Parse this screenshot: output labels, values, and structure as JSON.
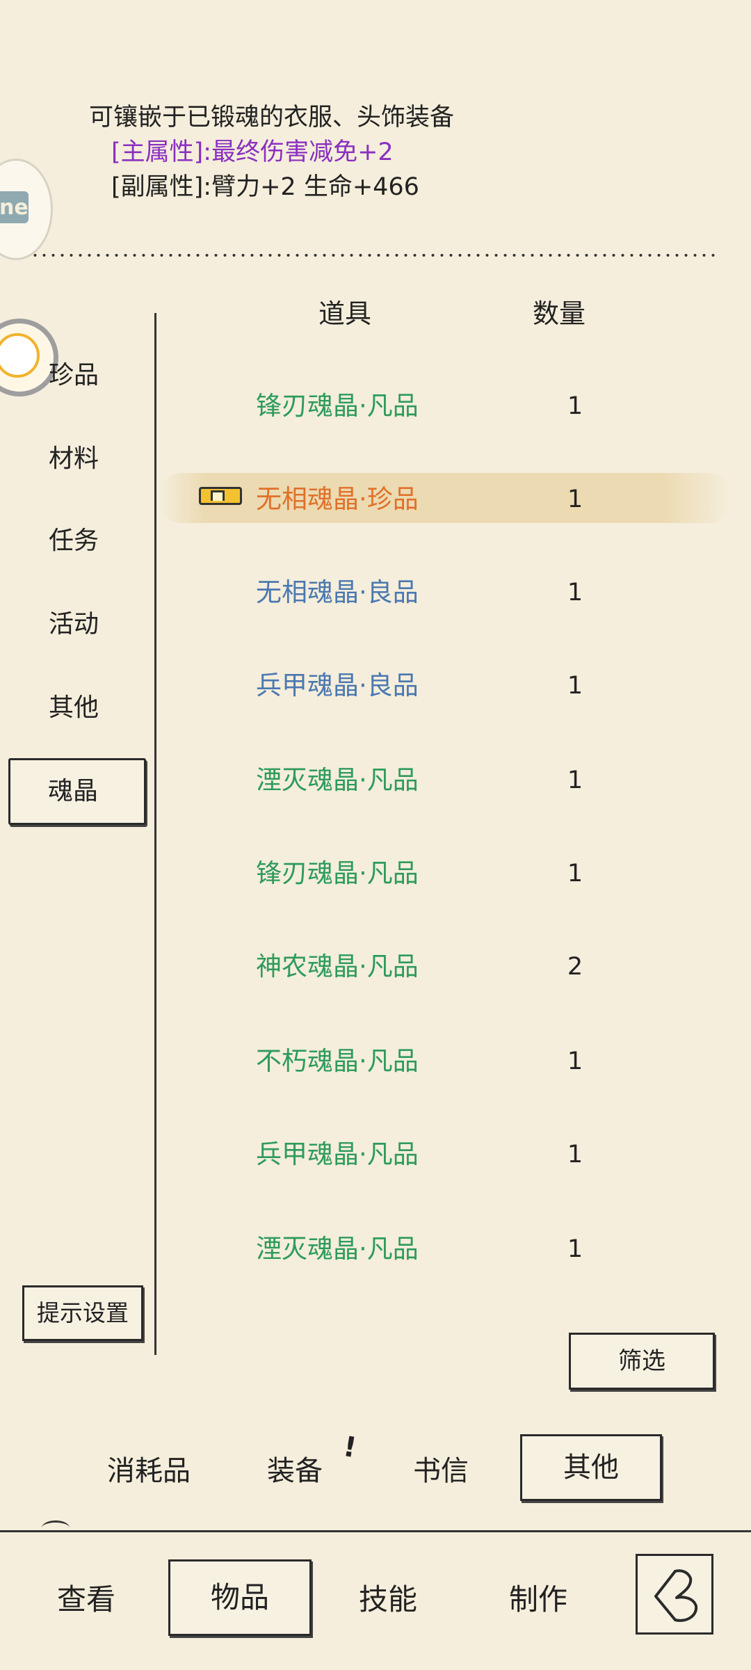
{
  "description": {
    "line1": "可镶嵌于已锻魂的衣服、头饰装备",
    "main_attr": "[主属性]:最终伤害减免+2",
    "sub_attr": "[副属性]:臂力+2 生命+466"
  },
  "avatar_top_text": "ne",
  "categories": [
    "珍品",
    "材料",
    "任务",
    "活动",
    "其他",
    "魂晶"
  ],
  "active_category": "魂晶",
  "table": {
    "header_item": "道具",
    "header_qty": "数量",
    "rows": [
      {
        "name": "锋刃魂晶·凡品",
        "qty": "1",
        "quality": "green"
      },
      {
        "name": "无相魂晶·珍品",
        "qty": "1",
        "quality": "orange",
        "selected": true
      },
      {
        "name": "无相魂晶·良品",
        "qty": "1",
        "quality": "blue"
      },
      {
        "name": "兵甲魂晶·良品",
        "qty": "1",
        "quality": "blue"
      },
      {
        "name": "湮灭魂晶·凡品",
        "qty": "1",
        "quality": "green"
      },
      {
        "name": "锋刃魂晶·凡品",
        "qty": "1",
        "quality": "green"
      },
      {
        "name": "神农魂晶·凡品",
        "qty": "2",
        "quality": "green"
      },
      {
        "name": "不朽魂晶·凡品",
        "qty": "1",
        "quality": "green"
      },
      {
        "name": "兵甲魂晶·凡品",
        "qty": "1",
        "quality": "green"
      },
      {
        "name": "湮灭魂晶·凡品",
        "qty": "1",
        "quality": "green"
      }
    ]
  },
  "buttons": {
    "hint_settings": "提示设置",
    "filter": "筛选"
  },
  "item_tabs": [
    "消耗品",
    "装备",
    "书信",
    "其他"
  ],
  "active_item_tab": "其他",
  "equip_alert": "!",
  "nav": [
    "查看",
    "物品",
    "技能",
    "制作"
  ],
  "active_nav": "物品",
  "colors": {
    "background": "#f5eedc",
    "quality_green": "#2e9b5b",
    "quality_blue": "#4a78b0",
    "quality_orange": "#e0712a",
    "main_attr_purple": "#8a2fc0"
  },
  "icons": {
    "back": "back-arrow-icon",
    "selected_tag": "equipped-tag-icon"
  }
}
